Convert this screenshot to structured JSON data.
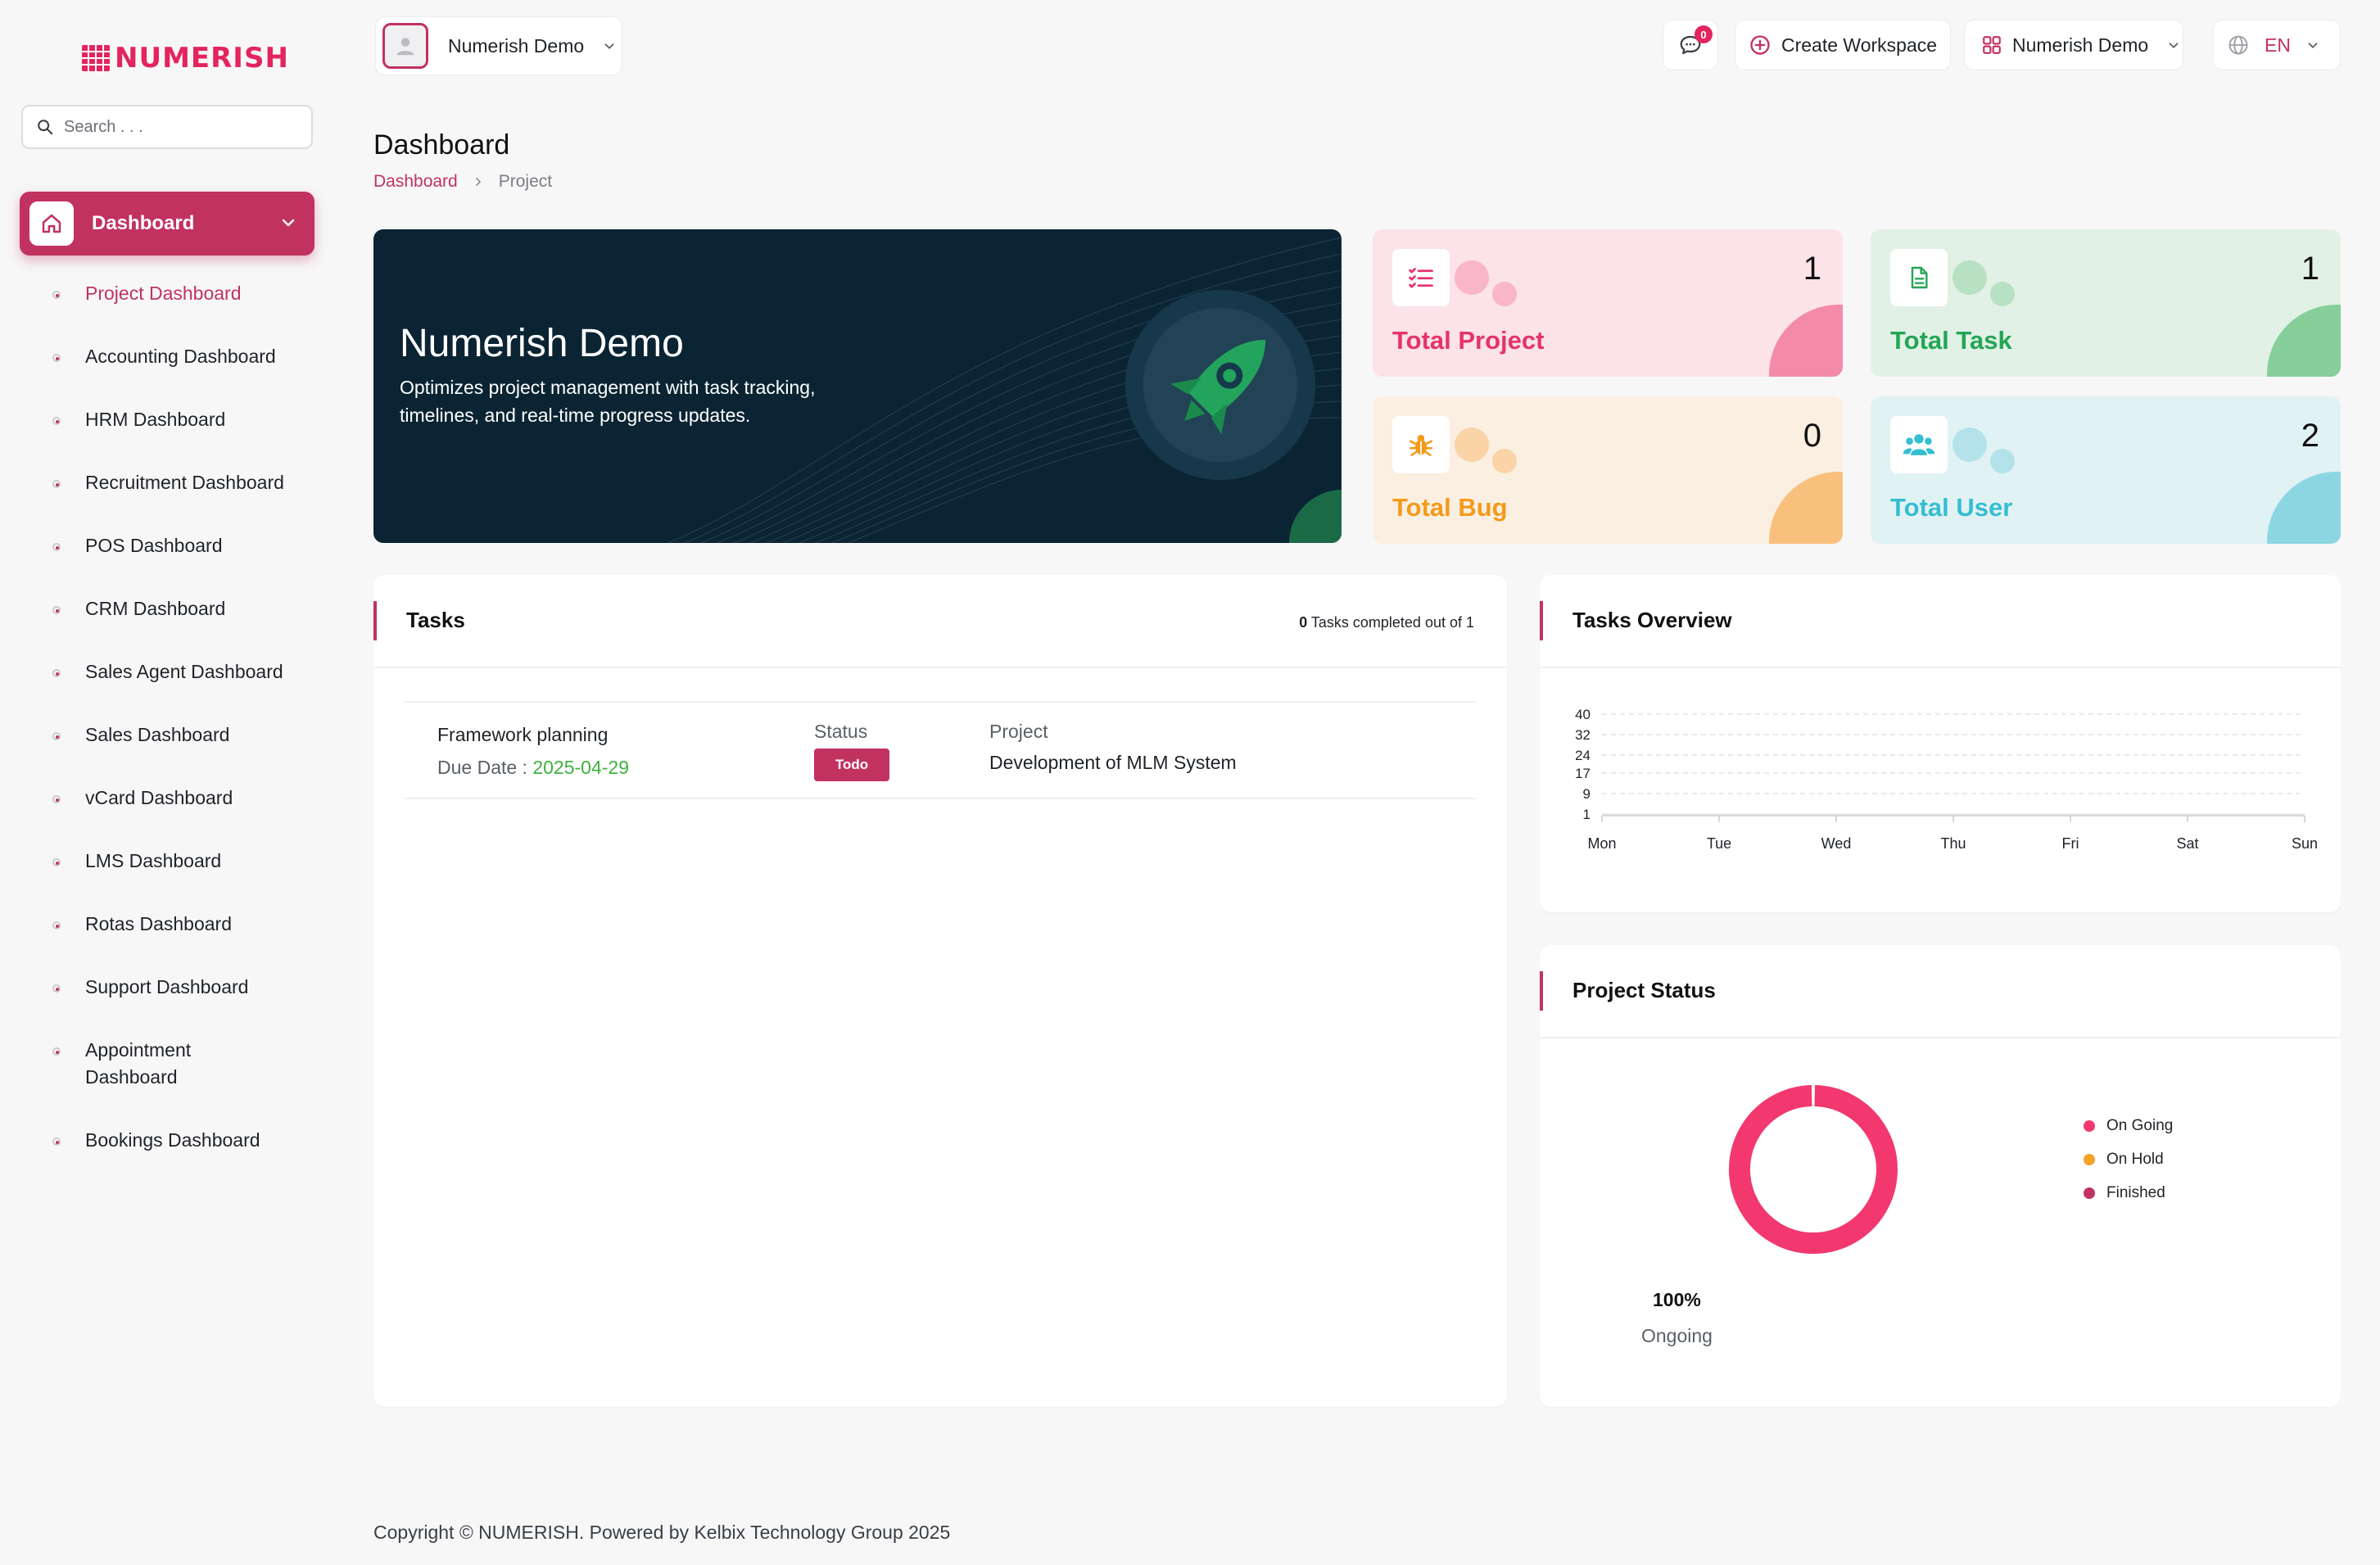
{
  "brand": {
    "name": "NUMERISH",
    "color": "#e3245f"
  },
  "search": {
    "placeholder": "Search . . ."
  },
  "sidebar": {
    "main_item": "Dashboard",
    "items": [
      {
        "label": "Project Dashboard",
        "active": true
      },
      {
        "label": "Accounting Dashboard"
      },
      {
        "label": "HRM Dashboard"
      },
      {
        "label": "Recruitment Dashboard"
      },
      {
        "label": "POS Dashboard"
      },
      {
        "label": "CRM Dashboard"
      },
      {
        "label": "Sales Agent Dashboard"
      },
      {
        "label": "Sales Dashboard"
      },
      {
        "label": "vCard Dashboard"
      },
      {
        "label": "LMS Dashboard"
      },
      {
        "label": "Rotas Dashboard"
      },
      {
        "label": "Support Dashboard"
      },
      {
        "label": "Appointment Dashboard"
      },
      {
        "label": "Bookings Dashboard"
      }
    ]
  },
  "header": {
    "workspace_name": "Numerish Demo",
    "notification_count": "0",
    "create_workspace": "Create Workspace",
    "workspace_switch": "Numerish Demo",
    "language": "EN"
  },
  "page": {
    "title": "Dashboard",
    "breadcrumb": [
      "Dashboard",
      "Project"
    ]
  },
  "hero": {
    "title": "Numerish Demo",
    "description": "Optimizes project management with task tracking, timelines, and real-time progress updates."
  },
  "stats": [
    {
      "label": "Total Project",
      "value": "1",
      "icon": "list-check-icon"
    },
    {
      "label": "Total Task",
      "value": "1",
      "icon": "file-text-icon"
    },
    {
      "label": "Total Bug",
      "value": "0",
      "icon": "bug-icon"
    },
    {
      "label": "Total User",
      "value": "2",
      "icon": "users-icon"
    }
  ],
  "tasks": {
    "title": "Tasks",
    "completed": "0",
    "completed_suffix": " Tasks completed out of 1",
    "items": [
      {
        "name": "Framework planning",
        "due_label": "Due Date : ",
        "due_date": "2025-04-29",
        "status_header": "Status",
        "status": "Todo",
        "project_header": "Project",
        "project": "Development of MLM System"
      }
    ]
  },
  "overview": {
    "title": "Tasks Overview"
  },
  "project_status": {
    "title": "Project Status",
    "legend": [
      {
        "label": "On Going",
        "color": "#f2386f"
      },
      {
        "label": "On Hold",
        "color": "#f6a32a"
      },
      {
        "label": "Finished",
        "color": "#c23260"
      }
    ],
    "percent": "100%",
    "percent_label": "Ongoing"
  },
  "chart_data": [
    {
      "type": "line",
      "categories": [
        "Mon",
        "Tue",
        "Wed",
        "Thu",
        "Fri",
        "Sat",
        "Sun"
      ],
      "yticks": [
        "40",
        "32",
        "24",
        "17",
        "9",
        "1"
      ],
      "series": [
        {
          "values": [
            1,
            1,
            1,
            1,
            1,
            1,
            1
          ]
        }
      ],
      "ylim": [
        1,
        40
      ],
      "grid": true
    },
    {
      "type": "pie",
      "labels": [
        "On Going",
        "On Hold",
        "Finished"
      ],
      "values": [
        100,
        0,
        0
      ],
      "colors": [
        "#f2386f",
        "#f6a32a",
        "#c23260"
      ]
    }
  ],
  "footer": {
    "text": "Copyright © NUMERISH. Powered by Kelbix Technology Group 2025"
  }
}
